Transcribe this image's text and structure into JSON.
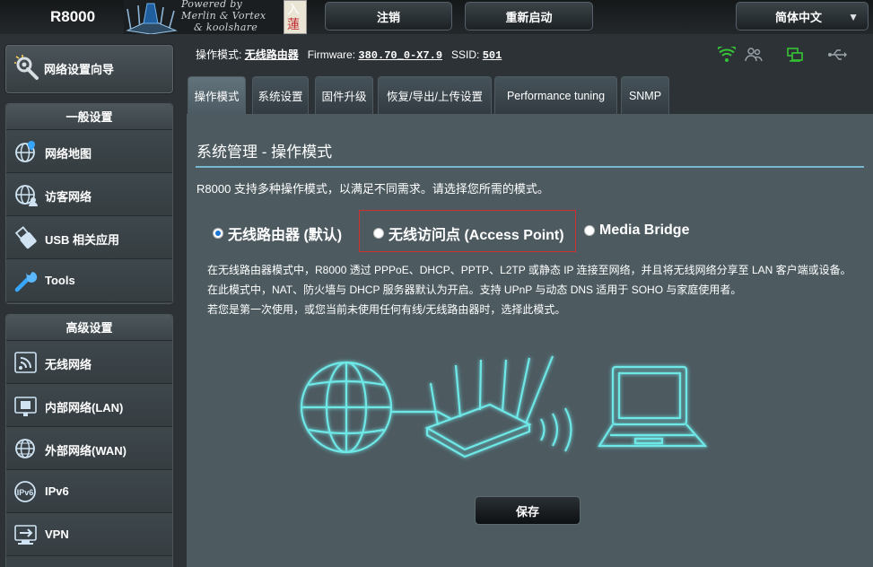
{
  "header": {
    "model": "R8000",
    "brand_lines": [
      "Powered by",
      "Merlin & Vortex",
      "& koolshare"
    ],
    "seal_chars": [
      "入",
      "蓮"
    ],
    "logout_label": "注销",
    "reboot_label": "重新启动",
    "language_label": "简体中文"
  },
  "sidebar": {
    "quick_setup": {
      "label": "网络设置向导",
      "icon": "wand-icon"
    },
    "general": {
      "title": "一般设置",
      "items": [
        {
          "label": "网络地图",
          "icon": "globe-map-icon"
        },
        {
          "label": "访客网络",
          "icon": "guest-globe-icon"
        },
        {
          "label": "USB 相关应用",
          "icon": "usb-icon"
        },
        {
          "label": "Tools",
          "icon": "wrench-icon"
        }
      ]
    },
    "advanced": {
      "title": "高级设置",
      "items": [
        {
          "label": "无线网络",
          "icon": "wireless-icon"
        },
        {
          "label": "内部网络(LAN)",
          "icon": "lan-icon"
        },
        {
          "label": "外部网络(WAN)",
          "icon": "wan-globe-icon"
        },
        {
          "label": "IPv6",
          "icon": "ipv6-icon"
        },
        {
          "label": "VPN",
          "icon": "vpn-icon"
        }
      ]
    }
  },
  "status": {
    "mode_label": "操作模式:",
    "mode_value": "无线路由器",
    "firmware_label": "Firmware:",
    "firmware_value": "380.70_0-X7.9",
    "ssid_label": "SSID:",
    "ssid_value": "501",
    "icons": [
      "wifi-icon",
      "users-icon",
      "network-icon",
      "usb-status-icon"
    ]
  },
  "tabs": [
    {
      "label": "操作模式",
      "active": true
    },
    {
      "label": "系统设置",
      "active": false
    },
    {
      "label": "固件升级",
      "active": false
    },
    {
      "label": "恢复/导出/上传设置",
      "active": false
    },
    {
      "label": "Performance tuning",
      "active": false
    },
    {
      "label": "SNMP",
      "active": false
    }
  ],
  "content": {
    "title": "系统管理 - 操作模式",
    "intro": "R8000 支持多种操作模式，以满足不同需求。请选择您所需的模式。",
    "modes": [
      {
        "label": "无线路由器 (默认)",
        "selected": true
      },
      {
        "label": "无线访问点 (Access Point)",
        "selected": false
      },
      {
        "label": "Media Bridge",
        "selected": false
      }
    ],
    "description_lines": [
      "在无线路由器模式中，R8000 透过 PPPoE、DHCP、PPTP、L2TP 或静态 IP 连接至网络，并且将无线网络分享至 LAN 客户端或设备。",
      "在此模式中，NAT、防火墙与 DHCP 服务器默认为开启。支持 UPnP 与动态 DNS 适用于 SOHO 与家庭使用者。",
      "若您是第一次使用，或您当前未使用任何有线/无线路由器时，选择此模式。"
    ],
    "save_label": "保存"
  },
  "colors": {
    "accent_line": "#7cc1dd",
    "illustration": "#6ee7e7",
    "highlight_box": "#d13030",
    "status_green": "#35c435"
  }
}
